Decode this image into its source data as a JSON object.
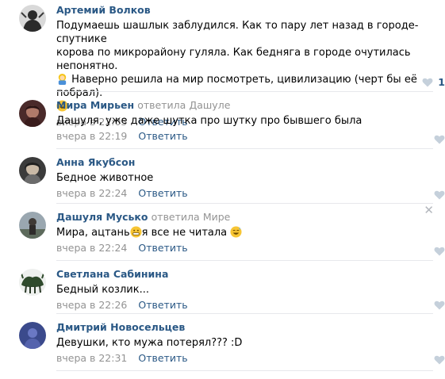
{
  "comments": [
    {
      "author": "Артемий Волков",
      "text_1": "Подумаешь шашлык заблудился. Как то пару лет назад в городе-спутнике",
      "text_2": "корова по микрорайону гуляла. Как бедняга в городе очутилась непонятно.",
      "text_3": " Наверно решила на мир посмотреть, цивилизацию (черт бы её побрал).",
      "date": "вчера в 22:05",
      "reply": "Ответить",
      "likes": "1"
    },
    {
      "author": "Мира Мирьен",
      "replied": "ответила",
      "replied_to": "Дашуле",
      "text": "Дашуля, уже даже шутка про шутку про бывшего была",
      "date": "вчера в 22:19",
      "reply": "Ответить"
    },
    {
      "author": "Анна Якубсон",
      "text": "Бедное животное",
      "date": "вчера в 22:24",
      "reply": "Ответить"
    },
    {
      "author": "Дашуля Мусько",
      "replied": "ответила",
      "replied_to": "Мире",
      "text_a": "Мира, ацтань",
      "text_b": "я все не читала ",
      "date": "вчера в 22:24",
      "reply": "Ответить",
      "close": "✕"
    },
    {
      "author": "Светлана Сабинина",
      "text": "Бедный козлик...",
      "date": "вчера в 22:26",
      "reply": "Ответить"
    },
    {
      "author": "Дмитрий Новосельцев",
      "text": "Девушки, кто мужа потерял??? :D",
      "date": "вчера в 22:31",
      "reply": "Ответить"
    }
  ],
  "colors": {
    "link": "#2a5885",
    "meta": "#939393",
    "divider": "#e7e8ec",
    "heart": "#c5d0db"
  },
  "icons": {
    "like": "heart-icon",
    "close": "close-icon",
    "emoji_1": "person-emoji-icon",
    "emoji_2": "grinning-emoji-icon",
    "emoji_3": "grimacing-emoji-icon",
    "emoji_4": "sweat-smile-emoji-icon"
  }
}
